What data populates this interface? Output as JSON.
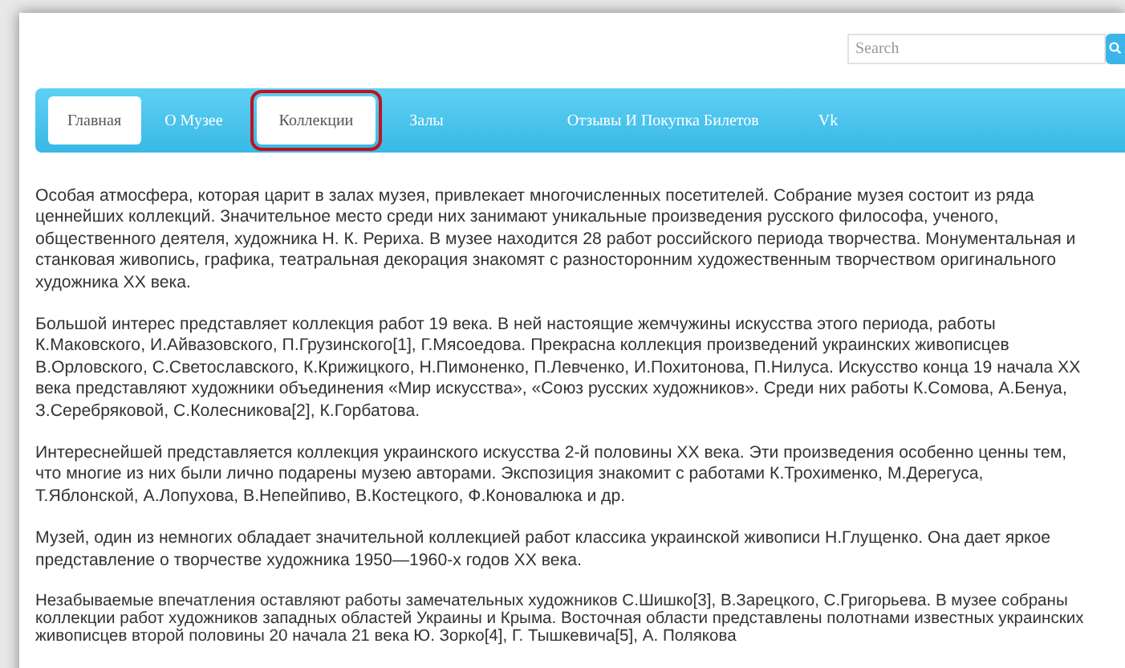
{
  "search": {
    "placeholder": "Search"
  },
  "nav": [
    {
      "label": "Главная",
      "selected": true,
      "outlined": false
    },
    {
      "label": "О Музее",
      "selected": false,
      "outlined": false
    },
    {
      "label": "Коллекции",
      "selected": true,
      "outlined": true
    },
    {
      "label": "Залы",
      "selected": false,
      "outlined": false
    },
    {
      "label": "Отзывы И Покупка Билетов",
      "selected": false,
      "outlined": false
    },
    {
      "label": "Vk",
      "selected": false,
      "outlined": false
    }
  ],
  "paragraphs": [
    "Особая атмосфера, которая царит в залах музея, привлекает многочисленных посетителей. Собрание музея состоит из ряда ценнейших коллекций. Значительное место среди них занимают уникальные произведения русского философа, ученого, общественного деятеля, художника Н. К. Рериха. В музее находится 28 работ российского периода творчества. Монументальная и станковая живопись, графика, театральная декорация знакомят с разносторонним художественным творчеством оригинального художника XX века.",
    "Большой интерес представляет коллекция работ 19 века. В ней настоящие жемчужины искусства этого периода, работы К.Маковского, И.Айвазовского, П.Грузинского[1], Г.Мясоедова. Прекрасна коллекция произведений украинских живописцев В.Орловского, С.Светославского, К.Крижицкого, Н.Пимоненко, П.Левченко, И.Похитонова, П.Нилуса. Искусство конца 19 начала XX века представляют художники объединения «Мир искусства», «Союз русских художников». Среди них работы К.Сомова, А.Бенуа, З.Серебряковой, С.Колесникова[2], К.Горбатова.",
    "Интереснейшей представляется коллекция украинского искусства 2-й половины XX века. Эти произведения особенно ценны тем, что многие из них были лично подарены музею авторами. Экспозиция знакомит с работами К.Трохименко, М.Дерегуса, Т.Яблонской, А.Лопухова, В.Непейпиво, В.Костецкого, Ф.Коновалюка и др.",
    "Музей, один из немногих обладает значительной коллекцией работ классика украинской живописи Н.Глущенко. Она дает яркое представление о творчестве художника 1950—1960-х годов XX века.",
    "Незабываемые впечатления оставляют работы замечательных художников С.Шишко[3], В.Зарецкого, С.Григорьева. В музее собраны коллекции работ художников западных областей Украины и Крыма. Восточная области представлены полотнами известных украинских живописцев второй половины 20 начала 21 века Ю. Зорко[4], Г. Тышкевича[5], А. Полякова"
  ]
}
